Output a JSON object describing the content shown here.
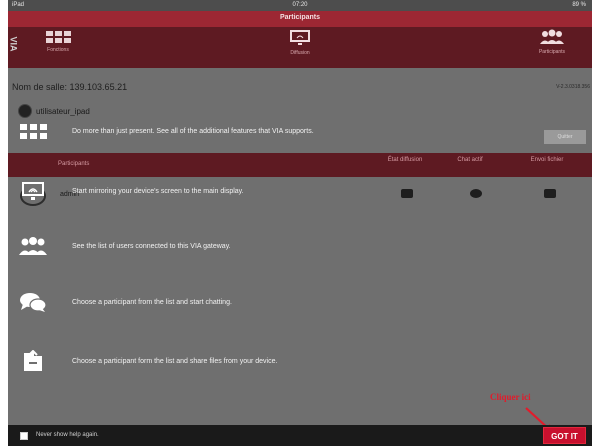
{
  "status_bar": {
    "left": "iPad",
    "time": "07:20",
    "battery": "89 %"
  },
  "header": {
    "title": "Participants",
    "logo": "VIA",
    "tabs": [
      {
        "label": "Fonctions",
        "icon": "grid-icon"
      },
      {
        "label": "Diffusion",
        "icon": "cast-screen-icon"
      },
      {
        "label": "Participants",
        "icon": "participants-icon"
      }
    ]
  },
  "room": {
    "label": "Nom de salle: 139.103.65.21",
    "version": "V-2.3.0318.356"
  },
  "user": {
    "name": "utilisateur_ipad",
    "quit_label": "Quitter"
  },
  "table": {
    "columns": [
      "Participants",
      "État diffusion",
      "Chat actif",
      "Envoi fichier"
    ],
    "rows": [
      {
        "name": "admin"
      }
    ]
  },
  "tips": [
    {
      "icon": "apps-grid-icon",
      "text": "Do more than just present.  See all of the additional features that VIA supports."
    },
    {
      "icon": "mirror-screen-icon",
      "text": "Start mirroring your device's screen to the main display."
    },
    {
      "icon": "users-group-icon",
      "text": "See the list of users connected to this VIA gateway."
    },
    {
      "icon": "chat-bubbles-icon",
      "text": "Choose a participant from the list and start chatting."
    },
    {
      "icon": "file-share-icon",
      "text": "Choose a participant form the list and share files from your device."
    }
  ],
  "annotation": {
    "text": "Cliquer ici",
    "color": "#e21b2b"
  },
  "bottom_bar": {
    "checkbox_label": "Never show help again.",
    "got_it": "GOT IT"
  },
  "colors": {
    "accent": "#9c2733",
    "header": "#5e1a22",
    "button": "#c8102e",
    "overlay": "#6f6f6f"
  }
}
